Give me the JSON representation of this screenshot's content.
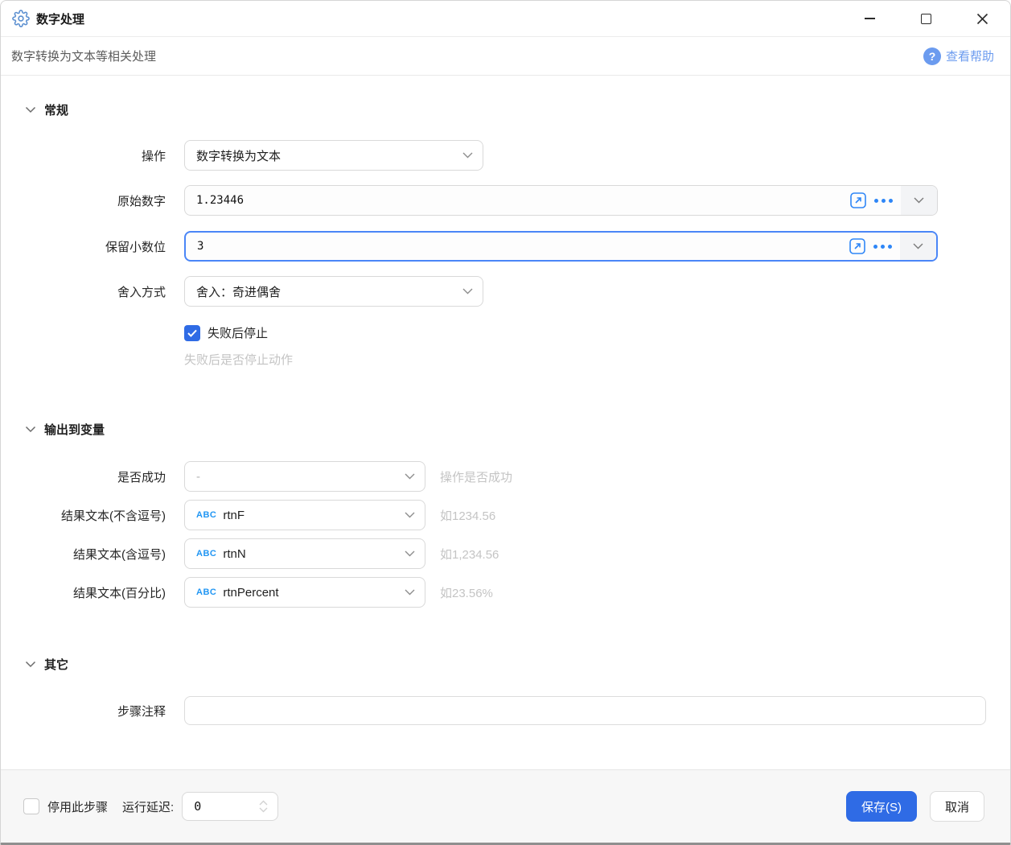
{
  "window": {
    "title": "数字处理",
    "subtitle": "数字转换为文本等相关处理",
    "help_icon": "?",
    "help_label": "查看帮助"
  },
  "general": {
    "header": "常规",
    "operation": {
      "label": "操作",
      "value": "数字转换为文本"
    },
    "source_number": {
      "label": "原始数字",
      "value": "1.23446"
    },
    "decimal_places": {
      "label": "保留小数位",
      "value": "3"
    },
    "rounding": {
      "label": "舍入方式",
      "value": "舍入：奇进偶舍"
    },
    "stop_on_fail": {
      "label": "失败后停止",
      "checked": true,
      "hint": "失败后是否停止动作"
    }
  },
  "output": {
    "header": "输出到变量",
    "success": {
      "label": "是否成功",
      "value": "-",
      "hint": "操作是否成功"
    },
    "result_plain": {
      "label": "结果文本(不含逗号)",
      "type_tag": "ABC",
      "value": "rtnF",
      "hint": "如1234.56"
    },
    "result_comma": {
      "label": "结果文本(含逗号)",
      "type_tag": "ABC",
      "value": "rtnN",
      "hint": "如1,234.56"
    },
    "result_percent": {
      "label": "结果文本(百分比)",
      "type_tag": "ABC",
      "value": "rtnPercent",
      "hint": "如23.56%"
    }
  },
  "other": {
    "header": "其它",
    "comment": {
      "label": "步骤注释",
      "value": ""
    }
  },
  "footer": {
    "disable_step_label": "停用此步骤",
    "delay_label": "运行延迟:",
    "delay_value": "0",
    "save_label": "保存(S)",
    "cancel_label": "取消"
  },
  "colors": {
    "accent_blue": "#2f6be5",
    "icon_blue": "#2e86f7",
    "focus_border": "#4a86f7",
    "help_blue": "#6b9bef",
    "hint_gray": "#c4c4c4"
  }
}
